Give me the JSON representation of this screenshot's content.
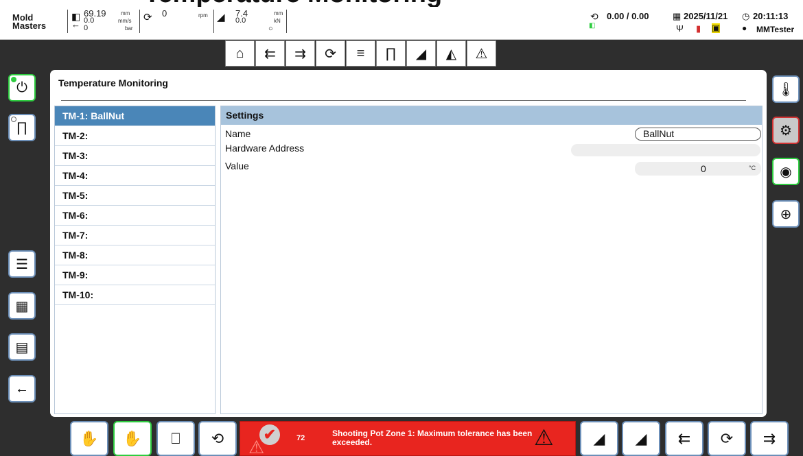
{
  "window_heading": "Temperature Monitoring",
  "status": {
    "logo_text_top": "Mold",
    "logo_text_bottom": "Masters",
    "injection": {
      "position": "69.19",
      "velocity": "0.0",
      "pressure": "0",
      "unit_pos": "mm",
      "unit_vel": "mm/s",
      "unit_pres": "bar"
    },
    "screw": {
      "value": "0",
      "unit": "rpm"
    },
    "clamp": {
      "position": "7.4",
      "force": "0.0",
      "unit_pos": "mm",
      "unit_force": "kN"
    },
    "cycle": "0.00 / 0.00",
    "date": "2025/11/21",
    "time": "20:11:13",
    "user": "MMTester"
  },
  "toolbar": {
    "icons": [
      "home-icon",
      "injection-icon",
      "hold-icon",
      "screw-icon",
      "nozzle-icon",
      "heater-icon",
      "clamp-icon",
      "mold-icon",
      "alarm-icon"
    ]
  },
  "panel": {
    "title": "Temperature Monitoring",
    "list": [
      "TM-1: BallNut",
      "TM-2:",
      "TM-3:",
      "TM-4:",
      "TM-5:",
      "TM-6:",
      "TM-7:",
      "TM-8:",
      "TM-9:",
      "TM-10:"
    ],
    "selected_index": 0
  },
  "settings": {
    "header": "Settings",
    "name_label": "Name",
    "name_value": "BallNut",
    "hw_label": "Hardware Address",
    "hw_value": "",
    "value_label": "Value",
    "value_value": "0",
    "value_unit": "°C"
  },
  "alarm": {
    "count": "72",
    "message": "Shooting Pot Zone 1: Maximum tolerance has been exceeded."
  },
  "colors": {
    "accent_active": "#2ecc40",
    "accent_alarm": "#e8251f",
    "selected_row": "#4a86b8",
    "settings_header": "#a7c3dc"
  }
}
